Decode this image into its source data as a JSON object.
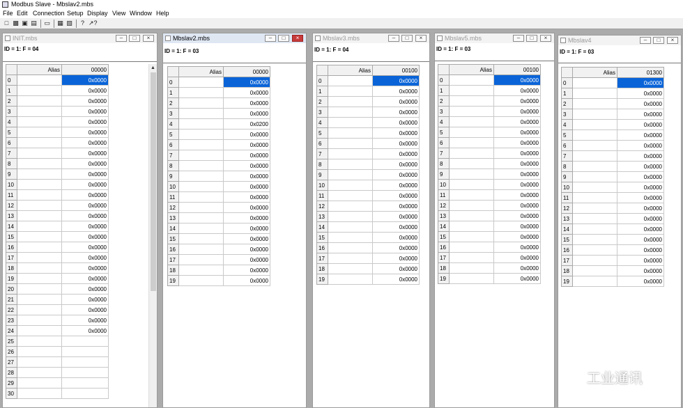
{
  "app": {
    "title": "Modbus Slave - Mbslav2.mbs",
    "menu": [
      "File",
      "Edit",
      "Connection",
      "Setup",
      "Display",
      "View",
      "Window",
      "Help"
    ],
    "toolbar_icons": [
      "new-icon",
      "open-icon",
      "save-icon",
      "print-icon",
      "window-icon",
      "log-icon",
      "print-preview-icon",
      "help-icon",
      "context-help-icon"
    ]
  },
  "windows": [
    {
      "title": "INIT.mbs",
      "status": "ID = 1: F = 04",
      "alias_header": "Alias",
      "address_header": "00000",
      "rows": [
        "0",
        "1",
        "2",
        "3",
        "4",
        "5",
        "6",
        "7",
        "8",
        "9",
        "10",
        "11",
        "12",
        "13",
        "14",
        "15",
        "16",
        "17",
        "18",
        "19",
        "20",
        "21",
        "22",
        "23",
        "24",
        "25",
        "26",
        "27",
        "28",
        "29",
        "30"
      ],
      "values": [
        "0x0000",
        "0x0000",
        "0x0000",
        "0x0000",
        "0x0000",
        "0x0000",
        "0x0000",
        "0x0000",
        "0x0000",
        "0x0000",
        "0x0000",
        "0x0000",
        "0x0000",
        "0x0000",
        "0x0000",
        "0x0000",
        "0x0000",
        "0x0000",
        "0x0000",
        "0x0000",
        "0x0000",
        "0x0000",
        "0x0000",
        "0x0000",
        "0x0000",
        "",
        "",
        "",
        "",
        "",
        ""
      ],
      "selected_row": 0
    },
    {
      "title": "Mbslav2.mbs",
      "status": "ID = 1: F = 03",
      "alias_header": "Alias",
      "address_header": "00000",
      "rows": [
        "0",
        "1",
        "2",
        "3",
        "4",
        "5",
        "6",
        "7",
        "8",
        "9",
        "10",
        "11",
        "12",
        "13",
        "14",
        "15",
        "16",
        "17",
        "18",
        "19"
      ],
      "values": [
        "0x0000",
        "0x0000",
        "0x0000",
        "0x0000",
        "0x0200",
        "0x0000",
        "0x0000",
        "0x0000",
        "0x0000",
        "0x0000",
        "0x0000",
        "0x0000",
        "0x0000",
        "0x0000",
        "0x0000",
        "0x0000",
        "0x0000",
        "0x0000",
        "0x0000",
        "0x0000"
      ],
      "selected_row": 0
    },
    {
      "title": "Mbslav3.mbs",
      "status": "ID = 1: F = 04",
      "alias_header": "Alias",
      "address_header": "00100",
      "rows": [
        "0",
        "1",
        "2",
        "3",
        "4",
        "5",
        "6",
        "7",
        "8",
        "9",
        "10",
        "11",
        "12",
        "13",
        "14",
        "15",
        "16",
        "17",
        "18",
        "19"
      ],
      "values": [
        "0x0000",
        "0x0000",
        "0x0000",
        "0x0000",
        "0x0000",
        "0x0000",
        "0x0000",
        "0x0000",
        "0x0000",
        "0x0000",
        "0x0000",
        "0x0000",
        "0x0000",
        "0x0000",
        "0x0000",
        "0x0000",
        "0x0000",
        "0x0000",
        "0x0000",
        "0x0000"
      ],
      "selected_row": 0
    },
    {
      "title": "Mbslav5.mbs",
      "status": "ID = 1: F = 03",
      "alias_header": "Alias",
      "address_header": "00100",
      "rows": [
        "0",
        "1",
        "2",
        "3",
        "4",
        "5",
        "6",
        "7",
        "8",
        "9",
        "10",
        "11",
        "12",
        "13",
        "14",
        "15",
        "16",
        "17",
        "18",
        "19"
      ],
      "values": [
        "0x0000",
        "0x0000",
        "0x0000",
        "0x0000",
        "0x0000",
        "0x0000",
        "0x0000",
        "0x0000",
        "0x0000",
        "0x0000",
        "0x0000",
        "0x0000",
        "0x0000",
        "0x0000",
        "0x0000",
        "0x0000",
        "0x0000",
        "0x0000",
        "0x0000",
        "0x0000"
      ],
      "selected_row": 0
    },
    {
      "title": "Mbslav4",
      "status": "ID = 1: F = 03",
      "alias_header": "Alias",
      "address_header": "01300",
      "rows": [
        "0",
        "1",
        "2",
        "3",
        "4",
        "5",
        "6",
        "7",
        "8",
        "9",
        "10",
        "11",
        "12",
        "13",
        "14",
        "15",
        "16",
        "17",
        "18",
        "19"
      ],
      "values": [
        "0x0000",
        "0x0000",
        "0x0000",
        "0x0000",
        "0x0000",
        "0x0000",
        "0x0000",
        "0x0000",
        "0x0000",
        "0x0000",
        "0x0000",
        "0x0000",
        "0x0000",
        "0x0000",
        "0x0000",
        "0x0000",
        "0x0000",
        "0x0000",
        "0x0000",
        "0x0000"
      ],
      "selected_row": 0
    }
  ],
  "watermark": {
    "text": "工业通讯"
  }
}
